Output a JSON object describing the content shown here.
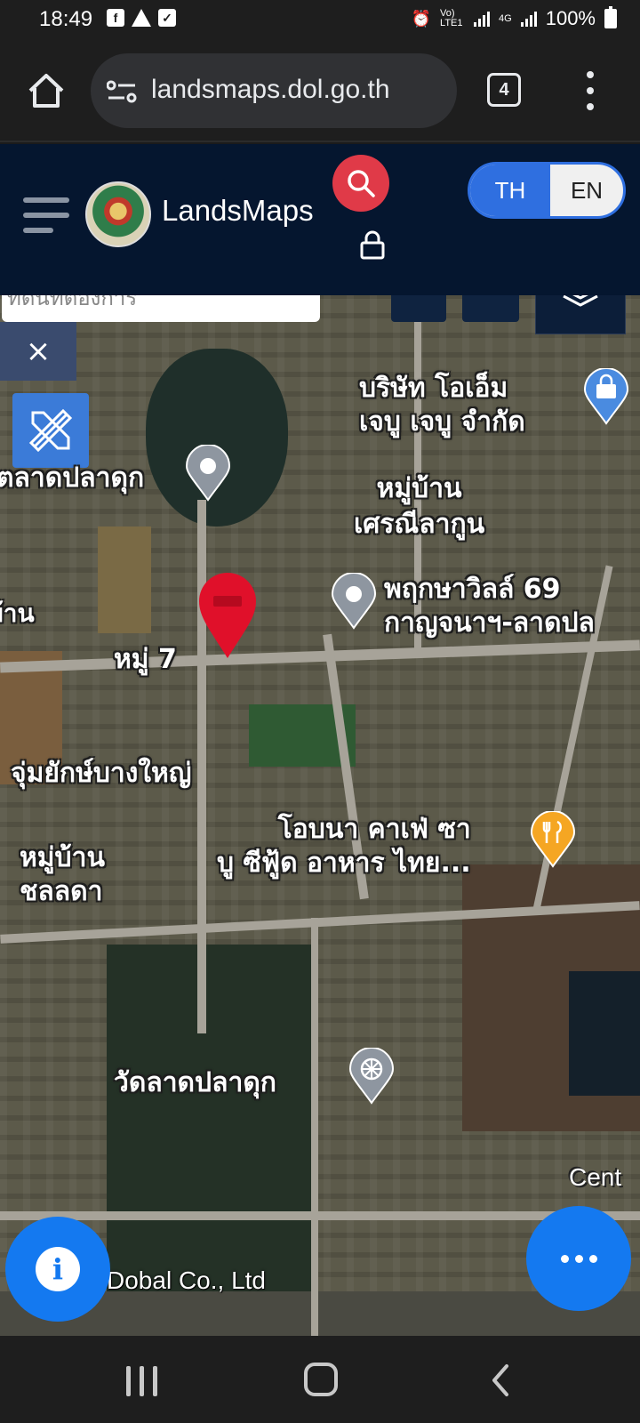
{
  "status_bar": {
    "time": "18:49",
    "volte_label": "Vo) LTE1",
    "network_label": "4G",
    "battery": "100%"
  },
  "browser": {
    "url": "landsmaps.dol.go.th",
    "tab_count": "4"
  },
  "app_header": {
    "brand": "LandsMaps",
    "lang_th": "TH",
    "lang_en": "EN",
    "selected_language": "TH"
  },
  "map": {
    "search_text": "ที่ดินที่ต้องการ",
    "close_symbol": "×",
    "copyright": "Dobal Co., Ltd",
    "labels": {
      "company": [
        "บริษัท โอเอ็ม",
        "เจบู เจบู จำกัด"
      ],
      "market": "ตลาดปลาดุก",
      "village_serni": [
        "หมู่บ้าน",
        "เศรณีลากูน"
      ],
      "pruksa": [
        "พฤกษาวิลล์ 69",
        "กาญจนาฯ-ลาดปล"
      ],
      "edge_left": "บ้าน",
      "moo7": "หมู่ 7",
      "jum_yak": "จุ่มยักษ์บางใหญ่",
      "restaurant": [
        "โอบนา คาเฟ่ ซา",
        "บู ซีฟู้ด อาหาร ไทย..."
      ],
      "village_chonlada": [
        "หมู่บ้าน",
        "ชลลดา"
      ],
      "temple": "วัดลาดปลาดุก",
      "cent": "Cent"
    }
  },
  "colors": {
    "header_bg": "#05162f",
    "accent_blue": "#2f6fe0",
    "search_red": "#e03a48",
    "fab_blue": "#1479f0",
    "pin_red": "#e0102a",
    "poi_orange": "#f5a623",
    "poi_blue": "#4a8be0"
  },
  "icons": [
    "home-icon",
    "site-settings-icon",
    "search-icon",
    "lock-icon",
    "layers-icon",
    "ruler-pencil-icon",
    "map-pin-icon",
    "poi-marker-icon",
    "info-icon",
    "more-icon",
    "wheel-icon",
    "restaurant-icon",
    "shopping-icon"
  ]
}
